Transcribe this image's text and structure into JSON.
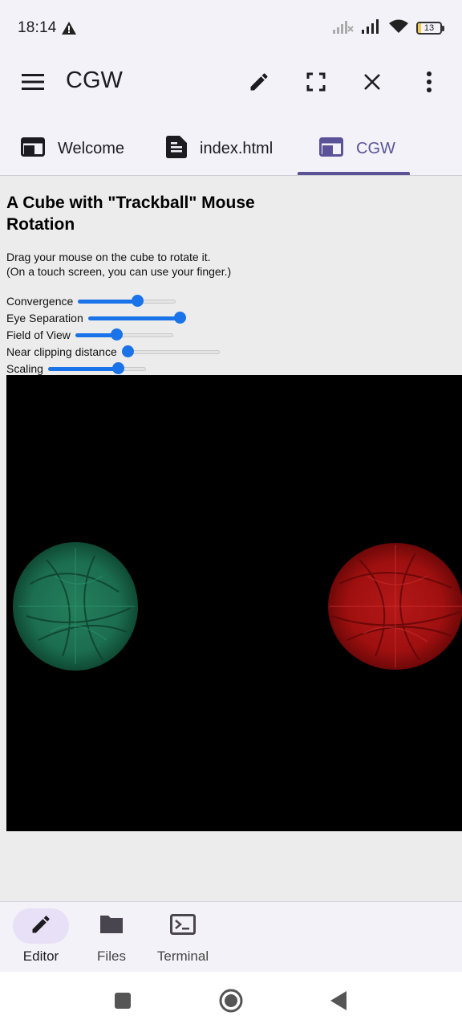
{
  "status_bar": {
    "time": "18:14",
    "battery_text": "13",
    "battery_level": 0.13
  },
  "app_bar": {
    "title": "CGW",
    "icons": [
      "menu-icon",
      "pencil-icon",
      "fullscreen-icon",
      "close-icon",
      "more-vert-icon"
    ]
  },
  "tabs": [
    {
      "label": "Welcome",
      "icon": "web-icon",
      "active": false
    },
    {
      "label": "index.html",
      "icon": "file-icon",
      "active": false
    },
    {
      "label": "CGW",
      "icon": "web-icon",
      "active": true
    }
  ],
  "page": {
    "heading": "A Cube with \"Trackball\" Mouse Rotation",
    "desc_line1": "Drag your mouse on the cube to rotate it.",
    "desc_line2": "(On a touch screen, you can use your finger.)",
    "controls": [
      {
        "label": "Convergence",
        "value": 0.62
      },
      {
        "label": "Eye Separation",
        "value": 0.99
      },
      {
        "label": "Field of View",
        "value": 0.41
      },
      {
        "label": "Near clipping distance",
        "value": 0.0
      },
      {
        "label": "Scaling",
        "value": 0.74
      }
    ],
    "canvas": {
      "left_color": "#1e7a5a",
      "right_color": "#b01414"
    }
  },
  "bottom_nav": [
    {
      "label": "Editor",
      "icon": "pencil-icon",
      "active": true
    },
    {
      "label": "Files",
      "icon": "folder-icon",
      "active": false
    },
    {
      "label": "Terminal",
      "icon": "terminal-icon",
      "active": false
    }
  ],
  "colors": {
    "accent": "#5b5397",
    "slider": "#1a73e8"
  }
}
